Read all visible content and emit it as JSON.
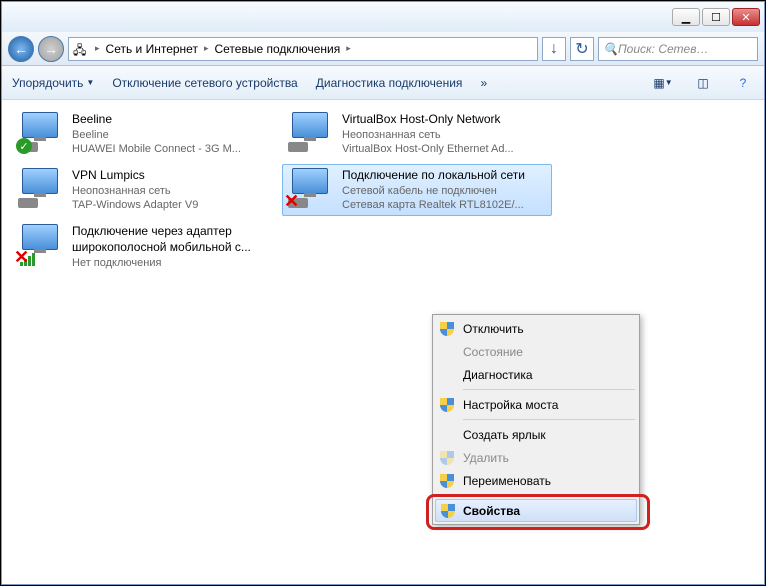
{
  "titlebar": {
    "min": "▁",
    "max": "☐",
    "close": "✕"
  },
  "nav": {
    "back": "←",
    "fwd": "→",
    "seg1": "Сеть и Интернет",
    "seg2": "Сетевые подключения",
    "refresh": "↻",
    "search_ph": "Поиск: Сетев…"
  },
  "toolbar": {
    "organize": "Упорядочить",
    "disable": "Отключение сетевого устройства",
    "diag": "Диагностика подключения",
    "more": "»"
  },
  "conns": [
    {
      "name": "Beeline",
      "sub1": "Beeline",
      "sub2": "HUAWEI Mobile Connect - 3G M..."
    },
    {
      "name": "VirtualBox Host-Only Network",
      "sub1": "Неопознанная сеть",
      "sub2": "VirtualBox Host-Only Ethernet Ad..."
    },
    {
      "name": "VPN Lumpics",
      "sub1": "Неопознанная сеть",
      "sub2": "TAP-Windows Adapter V9"
    },
    {
      "name": "Подключение по локальной сети",
      "sub1": "Сетевой кабель не подключен",
      "sub2": "Сетевая карта Realtek RTL8102E/..."
    },
    {
      "name": "Подключение через адаптер широкополосной мобильной с...",
      "sub1": "Нет подключения",
      "sub2": ""
    }
  ],
  "menu": {
    "disable": "Отключить",
    "status": "Состояние",
    "diag": "Диагностика",
    "bridge": "Настройка моста",
    "shortcut": "Создать ярлык",
    "delete": "Удалить",
    "rename": "Переименовать",
    "props": "Свойства"
  }
}
